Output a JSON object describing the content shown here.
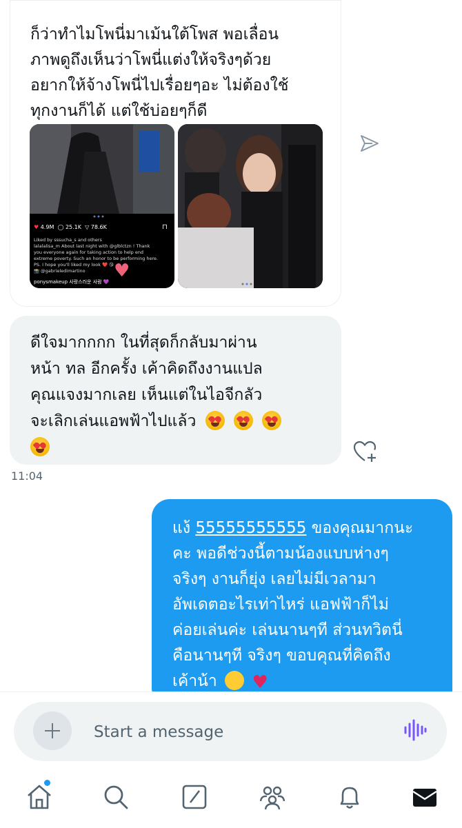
{
  "messages": {
    "incoming_media": {
      "text_lines": [
        "ก็ว่าทำไมโพนี่มาเม้นใต้โพส พอเลื่อน",
        "ภาพดูถึงเห็นว่าโพนี่แต่งให้จริงๆด้วย",
        "อยากให้จ้างโพนี่ไปเรื่อยๆอะ ไม่ต้องใช้",
        "ทุกงานก็ได้ แต่ใช้บ่อยๆก็ดี"
      ],
      "photo1": {
        "likes": "4.9M",
        "comments": "25.1K",
        "shares": "78.6K",
        "liked_by": "Liked by sssucha_s and others",
        "caption_lines": [
          "lalalalisa_m About last night with @glblctzn ! Thank",
          "you everyone again for taking action to help end",
          "extreme poverty. Such an honor to be performing here.",
          "PS. I hope you'll liked my look ❤️ 😘",
          "📸 @gabrieledimartino"
        ],
        "comment_user": "ponysmakeup",
        "comment_text": "사랑스러운 사람 💜"
      }
    },
    "incoming_text": {
      "text_lines": [
        "ดีใจมากกกก ในที่สุดก็กลับมาผ่าน",
        "หน้า ทล อีกครั้ง เค้าคิดถึงงานแปล",
        "คุณแจงมากเลย เห็นแต่ในไอจีกลัว",
        "จะเลิกเล่นแอพฟ้าไปแล้ว"
      ],
      "time": "11:04"
    },
    "outgoing": {
      "first_prefix": "แง้ ",
      "first_link": "55555555555",
      "first_suffix": " ของคุณมากนะ",
      "lines": [
        "คะ พอดีช่วงนี้ตามน้องแบบห่างๆ",
        "จริงๆ  งานก็ยุ่ง เลยไม่มีเวลามา",
        "อัพเดตอะไรเท่าไหร่ แอฟฟ้าก็ไม่",
        "ค่อยเล่นค่ะ เล่นนานๆที ส่วนทวิตนี่",
        "คือนานๆที จริงๆ ขอบคุณที่คิดถึง"
      ],
      "last_line": "เค้าน้า"
    }
  },
  "composer": {
    "placeholder": "Start a message"
  },
  "nav": [
    "home",
    "search",
    "communities",
    "people",
    "notifications",
    "messages"
  ],
  "colors": {
    "accent": "#1d9bf0",
    "bubble_in": "#eff3f4",
    "heart": "#e0245e"
  }
}
